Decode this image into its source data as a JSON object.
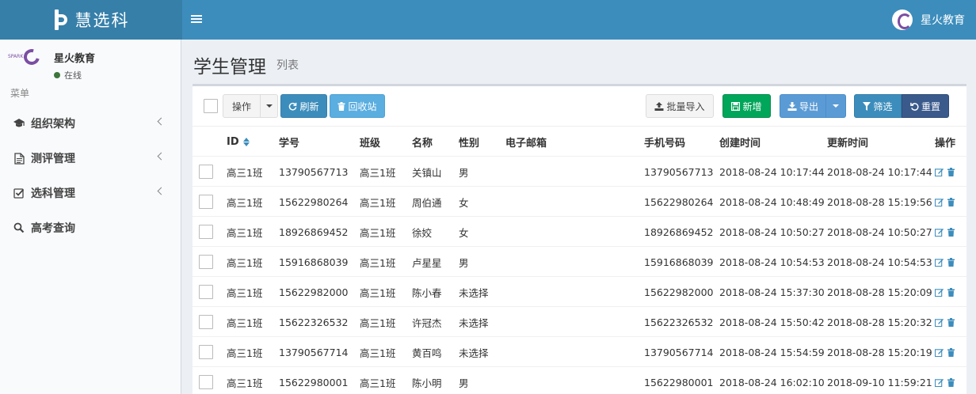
{
  "header": {
    "logo_text": "慧选科",
    "user_name": "星火教育"
  },
  "sidebar": {
    "user": {
      "name": "星火教育",
      "status": "在线",
      "avatar_text": "SPARK"
    },
    "menu_header": "菜单",
    "items": [
      {
        "label": "组织架构",
        "icon": "graduation-cap-icon",
        "has_children": true
      },
      {
        "label": "测评管理",
        "icon": "file-text-icon",
        "has_children": true
      },
      {
        "label": "选科管理",
        "icon": "check-square-icon",
        "has_children": true
      },
      {
        "label": "高考查询",
        "icon": "search-icon",
        "has_children": false
      }
    ]
  },
  "page": {
    "title": "学生管理",
    "subtitle": "列表"
  },
  "toolbar": {
    "operate_label": "操作",
    "refresh_label": "刷新",
    "recycle_label": "回收站",
    "import_label": "批量导入",
    "add_label": "新增",
    "export_label": "导出",
    "filter_label": "筛选",
    "reset_label": "重置"
  },
  "table": {
    "columns": [
      "ID",
      "学号",
      "班级",
      "名称",
      "性别",
      "电子邮箱",
      "手机号码",
      "创建时间",
      "更新时间",
      "操作"
    ],
    "rows": [
      {
        "id": "高三1班",
        "student_no": "13790567713",
        "class": "高三1班",
        "name": "关镇山",
        "gender": "男",
        "email": "",
        "phone": "13790567713",
        "created": "2018-08-24 10:17:44",
        "updated": "2018-08-24 10:17:44"
      },
      {
        "id": "高三1班",
        "student_no": "15622980264",
        "class": "高三1班",
        "name": "周伯通",
        "gender": "女",
        "email": "",
        "phone": "15622980264",
        "created": "2018-08-24 10:48:49",
        "updated": "2018-08-28 15:19:56"
      },
      {
        "id": "高三1班",
        "student_no": "18926869452",
        "class": "高三1班",
        "name": "徐姣",
        "gender": "女",
        "email": "",
        "phone": "18926869452",
        "created": "2018-08-24 10:50:27",
        "updated": "2018-08-24 10:50:27"
      },
      {
        "id": "高三1班",
        "student_no": "15916868039",
        "class": "高三1班",
        "name": "卢星星",
        "gender": "男",
        "email": "",
        "phone": "15916868039",
        "created": "2018-08-24 10:54:53",
        "updated": "2018-08-24 10:54:53"
      },
      {
        "id": "高三1班",
        "student_no": "15622982000",
        "class": "高三1班",
        "name": "陈小春",
        "gender": "未选择",
        "email": "",
        "phone": "15622982000",
        "created": "2018-08-24 15:37:30",
        "updated": "2018-08-28 15:20:09"
      },
      {
        "id": "高三1班",
        "student_no": "15622326532",
        "class": "高三1班",
        "name": "许冠杰",
        "gender": "未选择",
        "email": "",
        "phone": "15622326532",
        "created": "2018-08-24 15:50:42",
        "updated": "2018-08-28 15:20:32"
      },
      {
        "id": "高三1班",
        "student_no": "13790567714",
        "class": "高三1班",
        "name": "黄百鸣",
        "gender": "未选择",
        "email": "",
        "phone": "13790567714",
        "created": "2018-08-24 15:54:59",
        "updated": "2018-08-28 15:20:19"
      },
      {
        "id": "高三1班",
        "student_no": "15622980001",
        "class": "高三1班",
        "name": "陈小明",
        "gender": "男",
        "email": "",
        "phone": "15622980001",
        "created": "2018-08-24 16:02:10",
        "updated": "2018-09-10 11:59:21"
      }
    ]
  },
  "colors": {
    "header": "#3c8dbc",
    "logo_bg": "#367fa9",
    "success": "#00a65a",
    "accent": "#3c8dbc"
  }
}
